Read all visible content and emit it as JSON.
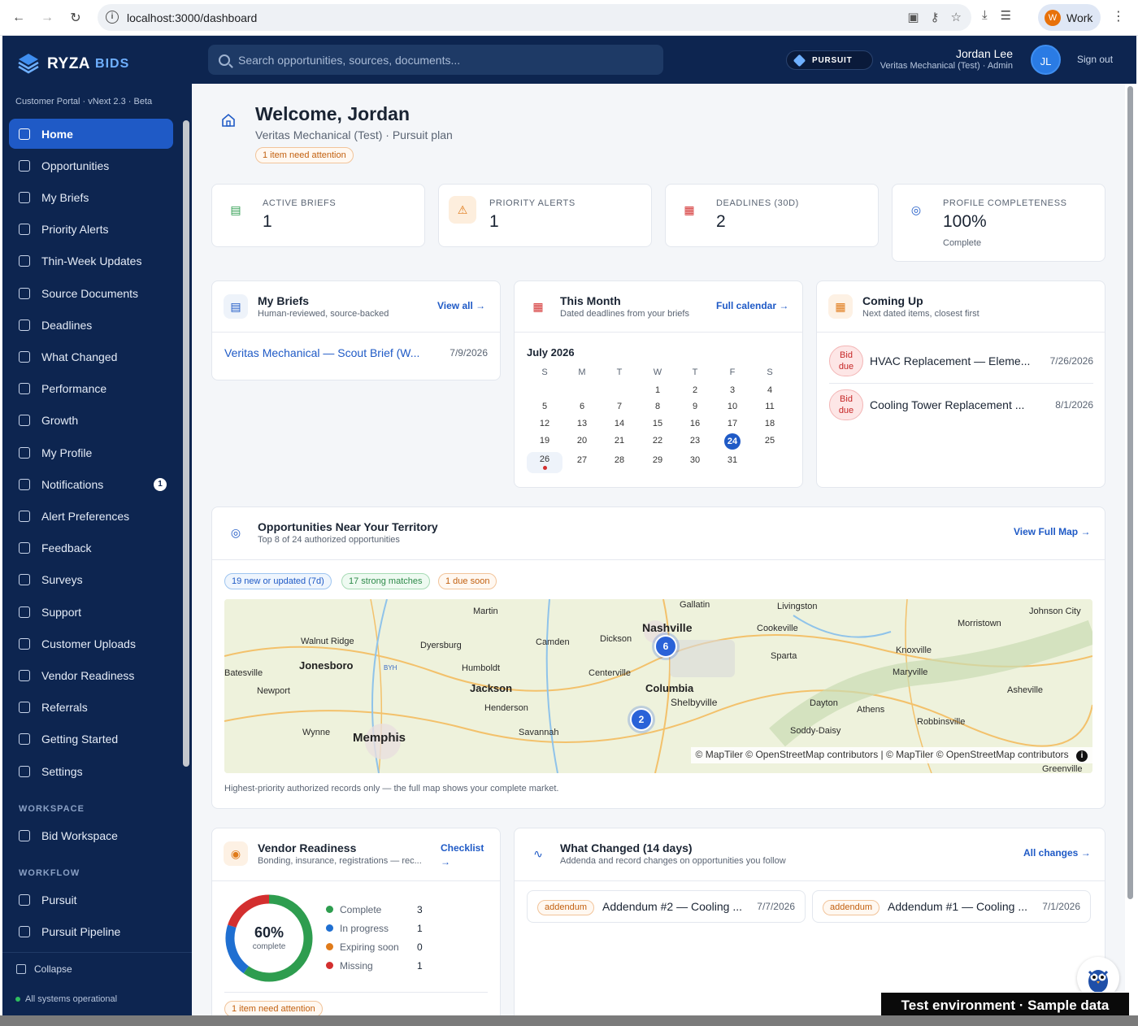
{
  "browser": {
    "url": "localhost:3000/dashboard",
    "profile_initial": "W",
    "profile_label": "Work"
  },
  "header": {
    "brand": "RYZA",
    "brand_suffix": "BIDS",
    "search_placeholder": "Search opportunities, sources, documents...",
    "plan_badge": "PURSUIT",
    "user_name": "Jordan Lee",
    "user_org": "Veritas Mechanical (Test) · Admin",
    "user_initials": "JL",
    "sign_out": "Sign out"
  },
  "sidebar": {
    "portal_label": "Customer Portal · vNext 2.3 · Beta",
    "items": [
      {
        "label": "Home",
        "icon": "home-icon"
      },
      {
        "label": "Opportunities",
        "icon": "compass-icon"
      },
      {
        "label": "My Briefs",
        "icon": "document-icon"
      },
      {
        "label": "Priority Alerts",
        "icon": "warning-icon"
      },
      {
        "label": "Thin-Week Updates",
        "icon": "refresh-icon"
      },
      {
        "label": "Source Documents",
        "icon": "files-icon"
      },
      {
        "label": "Deadlines",
        "icon": "calendar-icon"
      },
      {
        "label": "What Changed",
        "icon": "activity-icon"
      },
      {
        "label": "Performance",
        "icon": "trend-icon"
      },
      {
        "label": "Growth",
        "icon": "rocket-icon"
      },
      {
        "label": "My Profile",
        "icon": "user-circle-icon"
      },
      {
        "label": "Notifications",
        "icon": "bell-icon",
        "badge": "1"
      },
      {
        "label": "Alert Preferences",
        "icon": "sliders-icon"
      },
      {
        "label": "Feedback",
        "icon": "message-icon"
      },
      {
        "label": "Surveys",
        "icon": "clipboard-icon"
      },
      {
        "label": "Support",
        "icon": "lifebuoy-icon"
      },
      {
        "label": "Customer Uploads",
        "icon": "upload-icon"
      },
      {
        "label": "Vendor Readiness",
        "icon": "check-circle-icon"
      },
      {
        "label": "Referrals",
        "icon": "gift-icon"
      },
      {
        "label": "Getting Started",
        "icon": "rocket-icon"
      },
      {
        "label": "Settings",
        "icon": "gear-icon"
      }
    ],
    "section_workspace": "WORKSPACE",
    "workspace_items": [
      {
        "label": "Bid Workspace",
        "icon": "building-icon"
      }
    ],
    "section_workflow": "WORKFLOW",
    "workflow_items": [
      {
        "label": "Pursuit",
        "icon": "building-icon"
      },
      {
        "label": "Pursuit Pipeline",
        "icon": "building-icon"
      }
    ],
    "collapse": "Collapse",
    "status": "All systems operational"
  },
  "welcome": {
    "title": "Welcome, Jordan",
    "subtitle": "Veritas Mechanical (Test) · Pursuit plan",
    "attention": "1 item need attention"
  },
  "stats": [
    {
      "label": "ACTIVE BRIEFS",
      "value": "1",
      "icon": "document-icon",
      "color": "#2e9d4f"
    },
    {
      "label": "PRIORITY ALERTS",
      "value": "1",
      "icon": "warning-icon",
      "color": "#e07b1a"
    },
    {
      "label": "DEADLINES (30D)",
      "value": "2",
      "icon": "calendar-icon",
      "color": "#d32f2f"
    },
    {
      "label": "PROFILE COMPLETENESS",
      "value": "100%",
      "sub": "Complete",
      "icon": "user-circle-icon",
      "color": "#1f5ac6"
    }
  ],
  "briefs": {
    "title": "My Briefs",
    "subtitle": "Human-reviewed, source-backed",
    "link": "View all →",
    "item_title": "Veritas Mechanical — Scout Brief (W...",
    "item_date": "7/9/2026"
  },
  "calendar": {
    "title": "This Month",
    "subtitle": "Dated deadlines from your briefs",
    "link": "Full calendar →",
    "month": "July 2026",
    "weekdays": [
      "S",
      "M",
      "T",
      "W",
      "T",
      "F",
      "S"
    ],
    "first_weekday": 3,
    "days": 31,
    "today": 24,
    "event_days": [
      26
    ]
  },
  "coming_up": {
    "title": "Coming Up",
    "subtitle": "Next dated items, closest first",
    "items": [
      {
        "badge_line1": "Bid",
        "badge_line2": "due",
        "title": "HVAC Replacement — Eleme...",
        "date": "7/26/2026"
      },
      {
        "badge_line1": "Bid",
        "badge_line2": "due",
        "title": "Cooling Tower Replacement ...",
        "date": "8/1/2026"
      }
    ]
  },
  "territory": {
    "title": "Opportunities Near Your Territory",
    "subtitle": "Top 8 of 24 authorized opportunities",
    "link": "View Full Map →",
    "chips": [
      "19 new or updated (7d)",
      "17 strong matches",
      "1 due soon"
    ],
    "map_places": [
      "Gallatin",
      "Livingston",
      "Johnson City",
      "Nashville",
      "Cookeville",
      "Morristown",
      "Martin",
      "Walnut Ridge",
      "Dyersburg",
      "Camden",
      "Dickson",
      "Knoxville",
      "Sparta",
      "Jonesboro",
      "BYH",
      "Humboldt",
      "Centerville",
      "Maryville",
      "Batesville",
      "Newport",
      "Jackson",
      "Columbia",
      "Shelbyville",
      "Asheville",
      "Henderson",
      "Dayton",
      "Athens",
      "Robbinsville",
      "Wynne",
      "Savannah",
      "Soddy-Daisy",
      "Memphis",
      "Greenville"
    ],
    "clusters": [
      "6",
      "2"
    ],
    "attribution": "© MapTiler © OpenStreetMap contributors | © MapTiler © OpenStreetMap contributors",
    "footnote": "Highest-priority authorized records only — the full map shows your complete market."
  },
  "vendor": {
    "title": "Vendor Readiness",
    "subtitle": "Bonding, insurance, registrations — rec...",
    "link_line1": "Checklist",
    "link_line2": "→",
    "percent": "60%",
    "percent_label": "complete",
    "legend": [
      {
        "label": "Complete",
        "value": 3,
        "color": "#2e9d4f"
      },
      {
        "label": "In progress",
        "value": 1,
        "color": "#1f6fd1"
      },
      {
        "label": "Expiring soon",
        "value": 0,
        "color": "#e07b1a"
      },
      {
        "label": "Missing",
        "value": 1,
        "color": "#d32f2f"
      }
    ],
    "attention": "1 item need attention"
  },
  "changes": {
    "title": "What Changed (14 days)",
    "subtitle": "Addenda and record changes on opportunities you follow",
    "link": "All changes →",
    "items": [
      {
        "tag": "addendum",
        "title": "Addendum #2 — Cooling ...",
        "date": "7/7/2026"
      },
      {
        "tag": "addendum",
        "title": "Addendum #1 — Cooling ...",
        "date": "7/1/2026"
      }
    ]
  },
  "env_banner": "Test environment · Sample data"
}
